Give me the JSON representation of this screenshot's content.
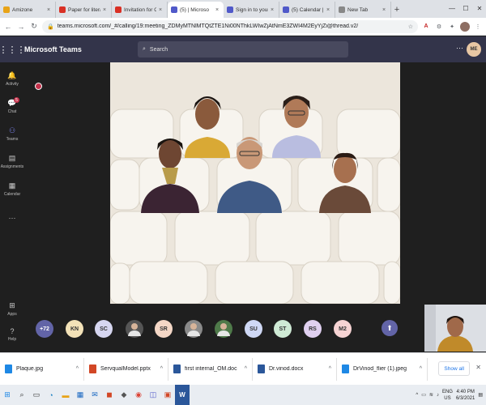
{
  "browser": {
    "tabs": [
      {
        "label": "Amizone",
        "favicon": "amizone-favicon",
        "color": "#e8a317",
        "active": false
      },
      {
        "label": "Paper for literatu",
        "favicon": "gmail-icon",
        "color": "#d93025",
        "active": false
      },
      {
        "label": "Invitation for Onl",
        "favicon": "gmail-icon",
        "color": "#d93025",
        "active": false
      },
      {
        "label": "(5) | Microso",
        "favicon": "teams-icon",
        "color": "#5059c9",
        "active": true
      },
      {
        "label": "Sign in to your a",
        "favicon": "microsoft-icon",
        "color": "#5059c9",
        "active": false
      },
      {
        "label": "(5) Calendar | Mic",
        "favicon": "teams-icon",
        "color": "#5059c9",
        "active": false
      },
      {
        "label": "New Tab",
        "favicon": "new-tab-icon",
        "color": "#888888",
        "active": false
      }
    ],
    "url": "teams.microsoft.com/_#/calling/19:meeting_ZDMyMTNlMTQtZTE1Ni00NThkLWIwZjAtNmE3ZWI4M2EyYjZi@thread.v2/"
  },
  "teams": {
    "app_title": "Microsoft Teams",
    "search_placeholder": "Search",
    "me_initials": "ME",
    "rail": [
      {
        "label": "Activity",
        "icon": "bell-icon",
        "badge": ""
      },
      {
        "label": "Chat",
        "icon": "chat-icon",
        "badge": "5"
      },
      {
        "label": "Teams",
        "icon": "teams-icon",
        "badge": ""
      },
      {
        "label": "Assignments",
        "icon": "assignments-icon",
        "badge": ""
      },
      {
        "label": "Calendar",
        "icon": "calendar-icon",
        "badge": ""
      },
      {
        "label": "...",
        "icon": "more-icon",
        "badge": ""
      },
      {
        "label": "Apps",
        "icon": "apps-icon",
        "badge": ""
      },
      {
        "label": "Help",
        "icon": "help-icon",
        "badge": ""
      }
    ]
  },
  "participants": [
    {
      "initials": "+72",
      "color": "#6264a7",
      "text_color": "#ffffff"
    },
    {
      "initials": "KN",
      "color": "#f3e2b8",
      "text_color": "#333333"
    },
    {
      "initials": "SC",
      "color": "#d6d6f0",
      "text_color": "#333333"
    },
    {
      "initials": "",
      "color": "#555555",
      "text_color": "#ffffff",
      "photo": true
    },
    {
      "initials": "SR",
      "color": "#f4d7c6",
      "text_color": "#333333"
    },
    {
      "initials": "",
      "color": "#8a8a8a",
      "text_color": "#ffffff",
      "photo": true
    },
    {
      "initials": "",
      "color": "#4f7a4a",
      "text_color": "#ffffff",
      "photo": true
    },
    {
      "initials": "SU",
      "color": "#cfd8f5",
      "text_color": "#333333"
    },
    {
      "initials": "ST",
      "color": "#cfead5",
      "text_color": "#333333"
    },
    {
      "initials": "RS",
      "color": "#e0d0f0",
      "text_color": "#333333"
    },
    {
      "initials": "M2",
      "color": "#f6d3d3",
      "text_color": "#333333"
    }
  ],
  "downloads": {
    "items": [
      {
        "name": "Plaque.jpg",
        "icon": "image-file-icon",
        "color": "#1e88e5"
      },
      {
        "name": "ServqualModel.pptx",
        "icon": "pptx-file-icon",
        "color": "#d24726"
      },
      {
        "name": "first internal_OM.doc",
        "icon": "doc-file-icon",
        "color": "#2b579a"
      },
      {
        "name": "Dr.vinod.docx",
        "icon": "doc-file-icon",
        "color": "#2b579a"
      },
      {
        "name": "DrVinod_flier (1).jpeg",
        "icon": "image-file-icon",
        "color": "#1e88e5"
      }
    ],
    "show_all": "Show all"
  },
  "taskbar": {
    "lang": "ENG",
    "region": "US",
    "time": "4:40 PM",
    "date": "6/3/2021"
  }
}
